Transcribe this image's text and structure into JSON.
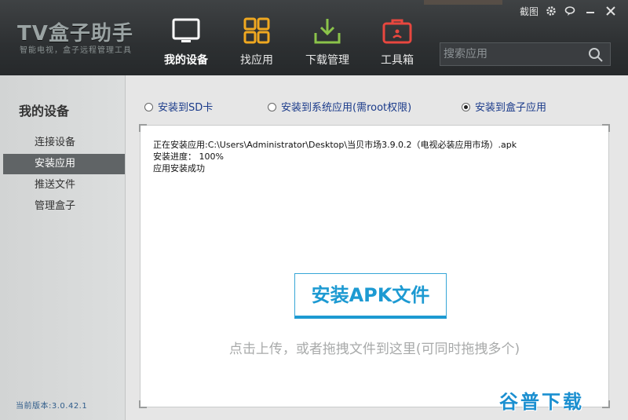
{
  "header": {
    "logo_title": "TV盒子助手",
    "logo_subtitle": "智能电视，盒子远程管理工具",
    "nav": [
      {
        "label": "我的设备",
        "icon": "tv-icon",
        "active": true
      },
      {
        "label": "找应用",
        "icon": "grid-icon",
        "active": false
      },
      {
        "label": "下载管理",
        "icon": "download-icon",
        "active": false
      },
      {
        "label": "工具箱",
        "icon": "toolbox-icon",
        "active": false
      }
    ],
    "search": {
      "placeholder": "搜索应用",
      "value": ""
    },
    "window_controls": {
      "screenshot_label": "截图"
    }
  },
  "sidebar": {
    "title": "我的设备",
    "items": [
      {
        "label": "连接设备",
        "active": false
      },
      {
        "label": "安装应用",
        "active": true
      },
      {
        "label": "推送文件",
        "active": false
      },
      {
        "label": "管理盒子",
        "active": false
      }
    ],
    "version": "当前版本:3.0.42.1"
  },
  "main": {
    "install_targets": [
      {
        "label": "安装到SD卡",
        "checked": false
      },
      {
        "label": "安装到系统应用(需root权限)",
        "checked": false
      },
      {
        "label": "安装到盒子应用",
        "checked": true
      }
    ],
    "log": [
      "正在安装应用:C:\\Users\\Administrator\\Desktop\\当贝市场3.9.0.2（电视必装应用市场）.apk",
      "安装进度：  100%",
      "应用安装成功"
    ],
    "install_button_label": "安装APK文件",
    "hint": "点击上传，或者拖拽文件到这里(可同时拖拽多个)"
  },
  "watermark": "谷普下载",
  "colors": {
    "accent": "#1d9ad2",
    "header_bg": "#2d3032",
    "sidebar_active": "#606466",
    "radio_text": "#1a3a8a",
    "version_text": "#2f5c8a"
  }
}
